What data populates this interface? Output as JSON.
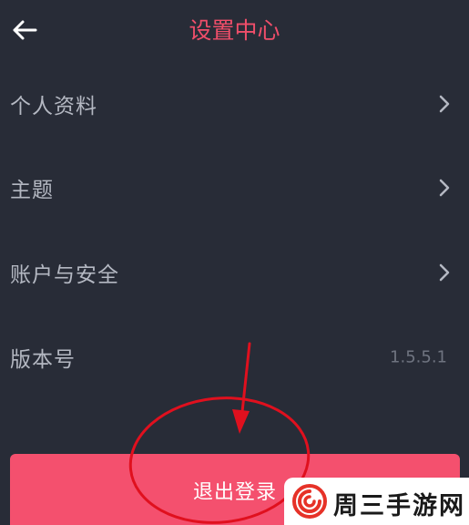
{
  "header": {
    "title": "设置中心",
    "back_icon": "arrow-left-icon"
  },
  "settings": {
    "items": [
      {
        "label": "个人资料",
        "icon": "chevron-right-icon"
      },
      {
        "label": "主题",
        "icon": "chevron-right-icon"
      },
      {
        "label": "账户与安全",
        "icon": "chevron-right-icon"
      },
      {
        "label": "版本号",
        "value": "1.5.5.1"
      }
    ]
  },
  "logout": {
    "label": "退出登录"
  },
  "watermark": {
    "text": "周三手游网"
  },
  "colors": {
    "background": "#282c37",
    "title": "#f04e6a",
    "row_text": "#b4b8c2",
    "value_text": "#6f7480",
    "logout_button": "#f4506e",
    "annotation": "#e0101e"
  }
}
